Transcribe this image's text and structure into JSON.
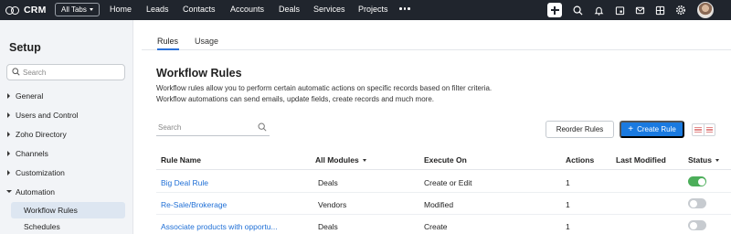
{
  "topbar": {
    "logo_text": "CRM",
    "all_tabs_label": "All Tabs",
    "nav": [
      {
        "label": "Home"
      },
      {
        "label": "Leads"
      },
      {
        "label": "Contacts"
      },
      {
        "label": "Accounts"
      },
      {
        "label": "Deals"
      },
      {
        "label": "Services"
      },
      {
        "label": "Projects"
      }
    ],
    "icons": [
      "plus-icon",
      "search-icon",
      "bell-icon",
      "calendar-icon",
      "mail-icon",
      "grid-icon",
      "gear-icon",
      "avatar"
    ]
  },
  "sidebar": {
    "title": "Setup",
    "search_placeholder": "Search",
    "items": [
      {
        "label": "General"
      },
      {
        "label": "Users and Control"
      },
      {
        "label": "Zoho Directory"
      },
      {
        "label": "Channels"
      },
      {
        "label": "Customization"
      },
      {
        "label": "Automation"
      }
    ],
    "sub_items": [
      {
        "label": "Workflow Rules",
        "active": true
      },
      {
        "label": "Schedules",
        "active": false
      }
    ]
  },
  "tabs": [
    {
      "label": "Rules",
      "active": true
    },
    {
      "label": "Usage",
      "active": false
    }
  ],
  "main": {
    "title": "Workflow Rules",
    "description_line1": "Workflow rules allow you to perform certain automatic actions on specific records based on filter criteria.",
    "description_line2": "Workflow automations can send emails, update fields, create records and much more.",
    "search_placeholder": "Search",
    "reorder_label": "Reorder Rules",
    "create_label": "Create Rule",
    "create_plus": "+"
  },
  "table": {
    "columns": {
      "rule_name": "Rule Name",
      "modules": "All Modules",
      "execute_on": "Execute On",
      "actions": "Actions",
      "last_modified": "Last Modified",
      "status": "Status"
    },
    "rows": [
      {
        "rule_name": "Big Deal Rule",
        "module": "Deals",
        "execute_on": "Create or Edit",
        "actions": "1",
        "last_modified": "",
        "status_on": true
      },
      {
        "rule_name": "Re-Sale/Brokerage",
        "module": "Vendors",
        "execute_on": "Modified",
        "actions": "1",
        "last_modified": "",
        "status_on": false
      },
      {
        "rule_name": "Associate products with opportu...",
        "module": "Deals",
        "execute_on": "Create",
        "actions": "1",
        "last_modified": "",
        "status_on": false
      }
    ]
  },
  "colors": {
    "topbar_bg": "#20252d",
    "accent": "#1a7ae0",
    "link": "#1f6fd6",
    "toggle_on": "#4cae5a",
    "toggle_off": "#c7cbd0"
  }
}
